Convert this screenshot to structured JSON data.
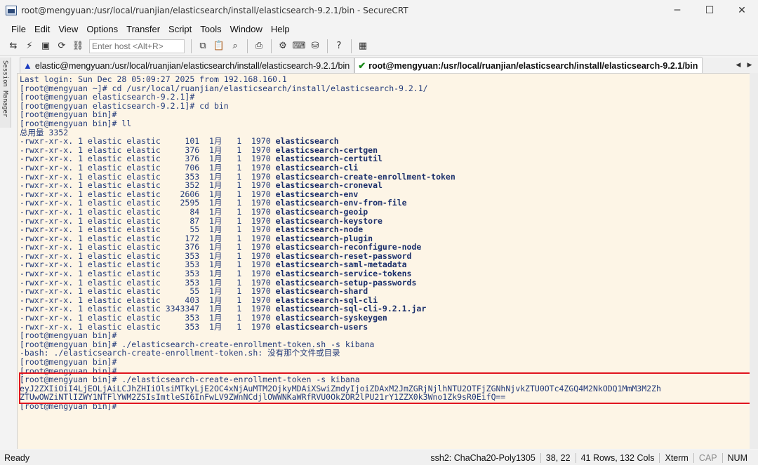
{
  "window": {
    "title": "root@mengyuan:/usr/local/ruanjian/elasticsearch/install/elasticsearch-9.2.1/bin - SecureCRT",
    "controls": {
      "minimize": "─",
      "maximize": "☐",
      "close": "✕"
    }
  },
  "menu": [
    "File",
    "Edit",
    "View",
    "Options",
    "Transfer",
    "Script",
    "Tools",
    "Window",
    "Help"
  ],
  "toolbar": {
    "host_placeholder": "Enter host <Alt+R>",
    "icons": [
      "connect-icon",
      "quick-connect-icon",
      "terminal-icon",
      "reconnect-icon",
      "disconnect-icon",
      "copy-icon",
      "paste-icon",
      "find-icon",
      "print-icon",
      "settings-icon",
      "keymap-icon",
      "sftp-icon",
      "help-icon",
      "screenshot-icon"
    ]
  },
  "session_manager": {
    "label": "Session Manager"
  },
  "tabs": [
    {
      "label": "elastic@mengyuan:/usr/local/ruanjian/elasticsearch/install/elasticsearch-9.2.1/bin",
      "status": "warning",
      "active": false
    },
    {
      "label": "root@mengyuan:/usr/local/ruanjian/elasticsearch/install/elasticsearch-9.2.1/bin",
      "status": "connected",
      "active": true
    }
  ],
  "terminal": {
    "lines": [
      {
        "text": "Last login: Sun Dec 28 05:09:27 2025 from 192.168.160.1"
      },
      {
        "text": "[root@mengyuan ~]# cd /usr/local/ruanjian/elasticsearch/install/elasticsearch-9.2.1/"
      },
      {
        "text": "[root@mengyuan elasticsearch-9.2.1]#"
      },
      {
        "text": "[root@mengyuan elasticsearch-9.2.1]# cd bin"
      },
      {
        "text": "[root@mengyuan bin]#"
      },
      {
        "text": "[root@mengyuan bin]# ll"
      },
      {
        "text": "总用量 3352"
      },
      {
        "text": "-rwxr-xr-x. 1 elastic elastic     101  1月   1  1970 ",
        "bold": "elasticsearch"
      },
      {
        "text": "-rwxr-xr-x. 1 elastic elastic     376  1月   1  1970 ",
        "bold": "elasticsearch-certgen"
      },
      {
        "text": "-rwxr-xr-x. 1 elastic elastic     376  1月   1  1970 ",
        "bold": "elasticsearch-certutil"
      },
      {
        "text": "-rwxr-xr-x. 1 elastic elastic     706  1月   1  1970 ",
        "bold": "elasticsearch-cli"
      },
      {
        "text": "-rwxr-xr-x. 1 elastic elastic     353  1月   1  1970 ",
        "bold": "elasticsearch-create-enrollment-token"
      },
      {
        "text": "-rwxr-xr-x. 1 elastic elastic     352  1月   1  1970 ",
        "bold": "elasticsearch-croneval"
      },
      {
        "text": "-rwxr-xr-x. 1 elastic elastic    2606  1月   1  1970 ",
        "bold": "elasticsearch-env"
      },
      {
        "text": "-rwxr-xr-x. 1 elastic elastic    2595  1月   1  1970 ",
        "bold": "elasticsearch-env-from-file"
      },
      {
        "text": "-rwxr-xr-x. 1 elastic elastic      84  1月   1  1970 ",
        "bold": "elasticsearch-geoip"
      },
      {
        "text": "-rwxr-xr-x. 1 elastic elastic      87  1月   1  1970 ",
        "bold": "elasticsearch-keystore"
      },
      {
        "text": "-rwxr-xr-x. 1 elastic elastic      55  1月   1  1970 ",
        "bold": "elasticsearch-node"
      },
      {
        "text": "-rwxr-xr-x. 1 elastic elastic     172  1月   1  1970 ",
        "bold": "elasticsearch-plugin"
      },
      {
        "text": "-rwxr-xr-x. 1 elastic elastic     376  1月   1  1970 ",
        "bold": "elasticsearch-reconfigure-node"
      },
      {
        "text": "-rwxr-xr-x. 1 elastic elastic     353  1月   1  1970 ",
        "bold": "elasticsearch-reset-password"
      },
      {
        "text": "-rwxr-xr-x. 1 elastic elastic     353  1月   1  1970 ",
        "bold": "elasticsearch-saml-metadata"
      },
      {
        "text": "-rwxr-xr-x. 1 elastic elastic     353  1月   1  1970 ",
        "bold": "elasticsearch-service-tokens"
      },
      {
        "text": "-rwxr-xr-x. 1 elastic elastic     353  1月   1  1970 ",
        "bold": "elasticsearch-setup-passwords"
      },
      {
        "text": "-rwxr-xr-x. 1 elastic elastic      55  1月   1  1970 ",
        "bold": "elasticsearch-shard"
      },
      {
        "text": "-rwxr-xr-x. 1 elastic elastic     403  1月   1  1970 ",
        "bold": "elasticsearch-sql-cli"
      },
      {
        "text": "-rwxr-xr-x. 1 elastic elastic 3343347  1月   1  1970 ",
        "bold": "elasticsearch-sql-cli-9.2.1.jar"
      },
      {
        "text": "-rwxr-xr-x. 1 elastic elastic     353  1月   1  1970 ",
        "bold": "elasticsearch-syskeygen"
      },
      {
        "text": "-rwxr-xr-x. 1 elastic elastic     353  1月   1  1970 ",
        "bold": "elasticsearch-users"
      },
      {
        "text": "[root@mengyuan bin]#"
      },
      {
        "text": "[root@mengyuan bin]# ./elasticsearch-create-enrollment-token.sh -s kibana"
      },
      {
        "text": "-bash: ./elasticsearch-create-enrollment-token.sh: 没有那个文件或目录"
      },
      {
        "text": "[root@mengyuan bin]#"
      },
      {
        "text": "[root@mengyuan bin]#"
      },
      {
        "text": "[root@mengyuan bin]# ./elasticsearch-create-enrollment-token -s kibana"
      },
      {
        "text": "eyJ2ZXIiOiI4LjEOLjAiLCJhZHIiOlsiMTkyLjE2OC4xNjAuMTM2OjkyMDAiXSwiZmdyIjoiZDAxM2JmZGRjNjlhNTU2OTFjZGNhNjvkZTU0OTc4ZGQ4M2NkODQ1MmM3M2Zh"
      },
      {
        "text": "ZTUwOWZiNTlIZWY1NTFlYWM2ZSIsImtleSI6InFwLV9ZWnNCdjlOWWNKaWRfRVU0OkZOR2lPU21rY1ZZX0k3Wno1Zk9sR0EifQ=="
      },
      {
        "text": "[root@mengyuan bin]#"
      }
    ]
  },
  "status": {
    "ready": "Ready",
    "cipher": "ssh2: ChaCha20-Poly1305",
    "cursor": "38,  22",
    "size": "41 Rows, 132 Cols",
    "emulation": "Xterm",
    "caps": "CAP",
    "num": "NUM"
  }
}
